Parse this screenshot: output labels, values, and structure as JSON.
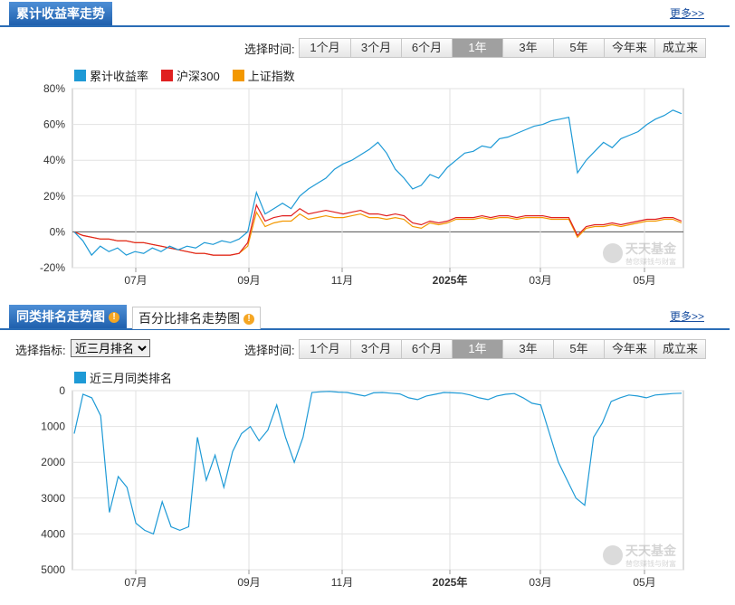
{
  "panel1": {
    "tab_label": "累计收益率走势",
    "more_label": "更多>>",
    "select_label": "选择时间:",
    "range_buttons": [
      "1个月",
      "3个月",
      "6个月",
      "1年",
      "3年",
      "5年",
      "今年来",
      "成立来"
    ],
    "active_range": "1年"
  },
  "panel2": {
    "tab_label": "同类排名走势图",
    "tab2_label": "百分比排名走势图",
    "more_label": "更多>>",
    "indicator_label": "选择指标:",
    "indicator_value": "近三月排名",
    "select_label": "选择时间:",
    "range_buttons": [
      "1个月",
      "3个月",
      "6个月",
      "1年",
      "3年",
      "5年",
      "今年来",
      "成立来"
    ],
    "active_range": "1年"
  },
  "watermark": {
    "text": "天天基金",
    "sub": "替您赚钱与财富"
  },
  "chart_data": [
    {
      "type": "line",
      "y_unit": "%",
      "ylim": [
        -20,
        80
      ],
      "yticks": [
        "80%",
        "60%",
        "40%",
        "20%",
        "0%",
        "-20%"
      ],
      "xticks": [
        "07月",
        "09月",
        "11月",
        "2025年",
        "03月",
        "05月"
      ],
      "grid": true,
      "legend_position": "top-left",
      "series": [
        {
          "name": "累计收益率",
          "color": "#1e9ad6",
          "values": [
            0,
            -5,
            -13,
            -8,
            -11,
            -9,
            -13,
            -11,
            -12,
            -9,
            -11,
            -8,
            -10,
            -8,
            -9,
            -6,
            -7,
            -5,
            -6,
            -4,
            0,
            22,
            10,
            13,
            16,
            13,
            20,
            24,
            27,
            30,
            35,
            38,
            40,
            43,
            46,
            50,
            44,
            35,
            30,
            24,
            26,
            32,
            30,
            36,
            40,
            44,
            45,
            48,
            47,
            52,
            53,
            55,
            57,
            59,
            60,
            62,
            63,
            64,
            33,
            40,
            45,
            50,
            47,
            52,
            54,
            56,
            60,
            63,
            65,
            68,
            66
          ]
        },
        {
          "name": "沪深300",
          "color": "#e02020",
          "values": [
            0,
            -2,
            -3,
            -4,
            -4,
            -5,
            -5,
            -6,
            -6,
            -7,
            -8,
            -9,
            -10,
            -11,
            -12,
            -12,
            -13,
            -13,
            -13,
            -12,
            -6,
            15,
            6,
            8,
            9,
            9,
            13,
            10,
            11,
            12,
            11,
            10,
            11,
            12,
            10,
            10,
            9,
            10,
            9,
            5,
            4,
            6,
            5,
            6,
            8,
            8,
            8,
            9,
            8,
            9,
            9,
            8,
            9,
            9,
            9,
            8,
            8,
            8,
            -2,
            3,
            4,
            4,
            5,
            4,
            5,
            6,
            7,
            7,
            8,
            8,
            6
          ]
        },
        {
          "name": "上证指数",
          "color": "#f39800",
          "values": [
            0,
            -2,
            -3,
            -4,
            -4,
            -5,
            -5,
            -6,
            -6,
            -7,
            -8,
            -9,
            -10,
            -11,
            -12,
            -12,
            -13,
            -13,
            -13,
            -12,
            -8,
            11,
            3,
            5,
            6,
            6,
            10,
            7,
            8,
            9,
            8,
            8,
            9,
            10,
            8,
            8,
            7,
            8,
            7,
            3,
            2,
            5,
            4,
            5,
            7,
            7,
            7,
            8,
            7,
            8,
            8,
            7,
            8,
            8,
            8,
            7,
            7,
            7,
            -3,
            2,
            3,
            3,
            4,
            3,
            4,
            5,
            6,
            6,
            7,
            7,
            5
          ]
        }
      ]
    },
    {
      "type": "line",
      "ylim": [
        0,
        5000
      ],
      "reversed": true,
      "yticks": [
        "0",
        "1000",
        "2000",
        "3000",
        "4000",
        "5000"
      ],
      "xticks": [
        "07月",
        "09月",
        "11月",
        "2025年",
        "03月",
        "05月"
      ],
      "grid": true,
      "legend_position": "top-left",
      "series": [
        {
          "name": "近三月同类排名",
          "color": "#1e9ad6",
          "values": [
            1200,
            100,
            200,
            700,
            3400,
            2400,
            2700,
            3700,
            3900,
            4000,
            3100,
            3800,
            3900,
            3800,
            1300,
            2500,
            1800,
            2700,
            1700,
            1200,
            1000,
            1400,
            1100,
            400,
            1300,
            2000,
            1300,
            50,
            30,
            20,
            40,
            50,
            100,
            150,
            60,
            50,
            70,
            90,
            200,
            250,
            150,
            100,
            50,
            60,
            70,
            120,
            200,
            250,
            150,
            100,
            80,
            200,
            350,
            400,
            1200,
            2000,
            2500,
            3000,
            3200,
            1300,
            900,
            300,
            200,
            120,
            150,
            200,
            120,
            100,
            80,
            70
          ]
        }
      ]
    }
  ]
}
